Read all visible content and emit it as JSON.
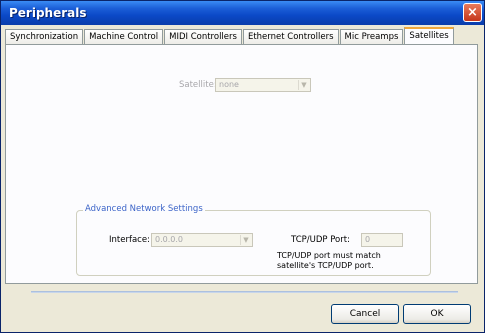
{
  "window": {
    "title": "Peripherals",
    "close_glyph": "×"
  },
  "tabs": [
    {
      "label": "Synchronization",
      "active": false
    },
    {
      "label": "Machine Control",
      "active": false
    },
    {
      "label": "MIDI Controllers",
      "active": false
    },
    {
      "label": "Ethernet Controllers",
      "active": false
    },
    {
      "label": "Mic Preamps",
      "active": false
    },
    {
      "label": "Satellites",
      "active": true
    }
  ],
  "satellites": {
    "satellite_label": "Satellite:",
    "satellite_value": "none"
  },
  "advanced": {
    "group_title": "Advanced Network Settings",
    "interface_label": "Interface:",
    "interface_value": "0.0.0.0",
    "port_label": "TCP/UDP Port:",
    "port_value": "0",
    "port_note_line1": "TCP/UDP port must match",
    "port_note_line2": "satellite's TCP/UDP port."
  },
  "buttons": {
    "cancel": "Cancel",
    "ok": "OK"
  },
  "colors": {
    "titlebar": "#0b49c7",
    "active_tab_highlight": "#f1a83a",
    "group_title": "#3c64c8",
    "disabled_text": "#a7a6aa"
  },
  "icons": {
    "close": "close-icon",
    "dropdown_arrow": "chevron-down-icon"
  }
}
